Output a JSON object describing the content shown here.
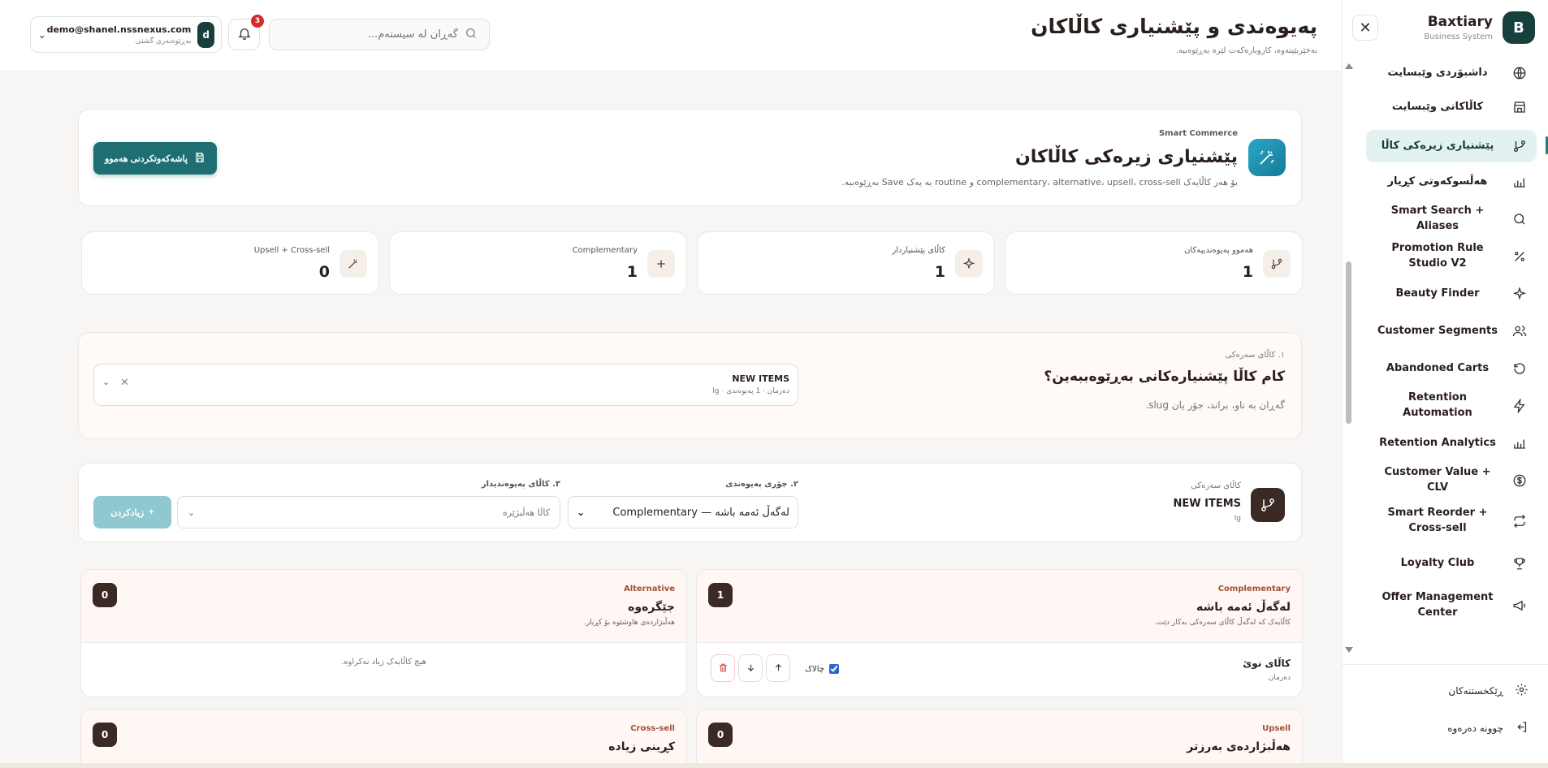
{
  "sidebar": {
    "brand_name": "Baxtiary",
    "brand_sub": "Business System",
    "brand_initial": "B",
    "items": [
      {
        "label": "داشبۆردی وێبسایت"
      },
      {
        "label": "کاڵاکانی وێبسایت"
      },
      {
        "label": "پێشنیاری زیرەکی کاڵا"
      },
      {
        "label": "هەڵسوکەوتی کڕیار"
      },
      {
        "label": "Smart Search + Aliases"
      },
      {
        "label": "Promotion Rule Studio V2"
      },
      {
        "label": "Beauty Finder"
      },
      {
        "label": "Customer Segments"
      },
      {
        "label": "Abandoned Carts"
      },
      {
        "label": "Retention Automation"
      },
      {
        "label": "Retention Analytics"
      },
      {
        "label": "Customer Value + CLV"
      },
      {
        "label": "Smart Reorder + Cross-sell"
      },
      {
        "label": "Loyalty Club"
      },
      {
        "label": "Offer Management Center"
      }
    ],
    "footer": {
      "settings": "ڕێکخستنەکان",
      "logout": "چوونە دەرەوە"
    }
  },
  "header": {
    "title": "پەیوەندی و پێشنیاری کاڵاکان",
    "subtitle": "بەخێربێیتەوە، کاروبارەکەت لێرە بەڕێوەببە.",
    "search_placeholder": "گەڕان لە سیستەم...",
    "notification_count": "3",
    "user_email": "demo@shanel.nssnexus.com",
    "user_role": "بەڕێوەبەری گشتی",
    "user_initial": "d"
  },
  "hero": {
    "kicker": "Smart Commerce",
    "title": "پێشنیاری زیرەکی کاڵاکان",
    "description": "بۆ هەر کاڵایەک complementary، alternative، upsell، cross-sell و routine بە یەک Save بەڕێوەببە.",
    "save_all": "پاشەکەوتکردنی هەموو"
  },
  "stats": [
    {
      "label": "هەموو پەیوەندییەکان",
      "value": "1"
    },
    {
      "label": "کاڵای پێشنیاردار",
      "value": "1"
    },
    {
      "label": "Complementary",
      "value": "1"
    },
    {
      "label": "Upsell + Cross-sell",
      "value": "0"
    }
  ],
  "source": {
    "kicker": "١. کاڵای سەرەکی",
    "title": "کام کاڵا پێشنیارەکانی بەڕێوەببەین؟",
    "hint": "گەڕان بە ناو، براند، جۆر یان slug.",
    "selected_name": "NEW ITEMS",
    "selected_sub": "دەرمان · 1 پەیوەندی · lg"
  },
  "relation": {
    "kicker": "کاڵای سەرەکی",
    "name": "NEW ITEMS",
    "sub": "lg",
    "type_label": "٢. جۆری پەیوەندی",
    "type_value": "لەگەڵ ئەمە باشە — Complementary",
    "product_label": "٣. کاڵای پەیوەندیدار",
    "product_placeholder": "کاڵا هەڵبژێرە",
    "add_label": "زیادکردن"
  },
  "groups": [
    {
      "kicker": "Complementary",
      "title": "لەگەڵ ئەمە باشە",
      "desc": "کاڵایەک کە لەگەڵ کاڵای سەرەکی بەکار دێت.",
      "count": "1",
      "row": {
        "name": "کاڵای نوێ",
        "sub": "دەرمان",
        "active_label": "چالاک"
      }
    },
    {
      "kicker": "Alternative",
      "title": "جێگرەوە",
      "desc": "هەڵبژاردەی هاوشێوە بۆ کڕیار.",
      "count": "0",
      "empty": "هیچ کاڵایەک زیاد نەکراوە."
    },
    {
      "kicker": "Upsell",
      "title": "هەڵبژاردەی بەرزتر",
      "count": "0"
    },
    {
      "kicker": "Cross-sell",
      "title": "کڕینی زیادە",
      "count": "0"
    }
  ]
}
